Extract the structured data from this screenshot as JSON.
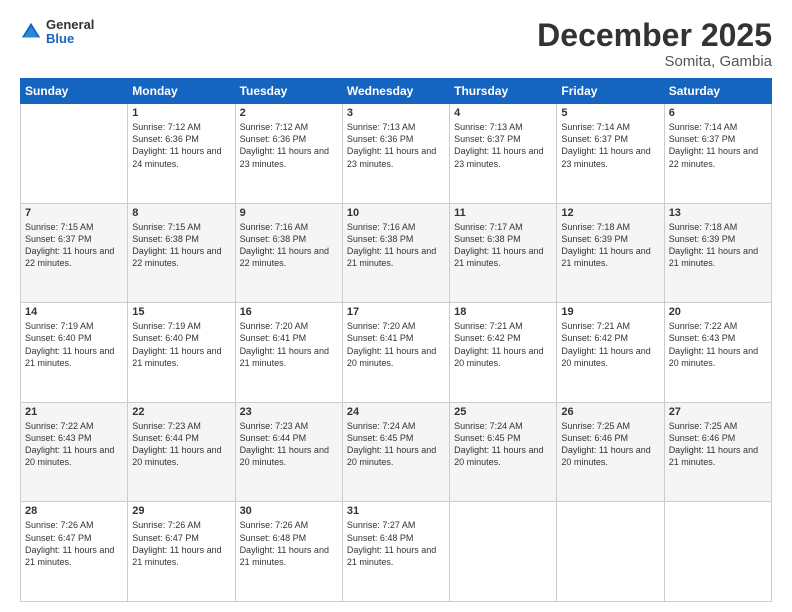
{
  "header": {
    "logo": {
      "general": "General",
      "blue": "Blue"
    },
    "title": "December 2025",
    "subtitle": "Somita, Gambia"
  },
  "days_of_week": [
    "Sunday",
    "Monday",
    "Tuesday",
    "Wednesday",
    "Thursday",
    "Friday",
    "Saturday"
  ],
  "weeks": [
    [
      {
        "day": "",
        "sunrise": "",
        "sunset": "",
        "daylight": ""
      },
      {
        "day": "1",
        "sunrise": "Sunrise: 7:12 AM",
        "sunset": "Sunset: 6:36 PM",
        "daylight": "Daylight: 11 hours and 24 minutes."
      },
      {
        "day": "2",
        "sunrise": "Sunrise: 7:12 AM",
        "sunset": "Sunset: 6:36 PM",
        "daylight": "Daylight: 11 hours and 23 minutes."
      },
      {
        "day": "3",
        "sunrise": "Sunrise: 7:13 AM",
        "sunset": "Sunset: 6:36 PM",
        "daylight": "Daylight: 11 hours and 23 minutes."
      },
      {
        "day": "4",
        "sunrise": "Sunrise: 7:13 AM",
        "sunset": "Sunset: 6:37 PM",
        "daylight": "Daylight: 11 hours and 23 minutes."
      },
      {
        "day": "5",
        "sunrise": "Sunrise: 7:14 AM",
        "sunset": "Sunset: 6:37 PM",
        "daylight": "Daylight: 11 hours and 23 minutes."
      },
      {
        "day": "6",
        "sunrise": "Sunrise: 7:14 AM",
        "sunset": "Sunset: 6:37 PM",
        "daylight": "Daylight: 11 hours and 22 minutes."
      }
    ],
    [
      {
        "day": "7",
        "sunrise": "Sunrise: 7:15 AM",
        "sunset": "Sunset: 6:37 PM",
        "daylight": "Daylight: 11 hours and 22 minutes."
      },
      {
        "day": "8",
        "sunrise": "Sunrise: 7:15 AM",
        "sunset": "Sunset: 6:38 PM",
        "daylight": "Daylight: 11 hours and 22 minutes."
      },
      {
        "day": "9",
        "sunrise": "Sunrise: 7:16 AM",
        "sunset": "Sunset: 6:38 PM",
        "daylight": "Daylight: 11 hours and 22 minutes."
      },
      {
        "day": "10",
        "sunrise": "Sunrise: 7:16 AM",
        "sunset": "Sunset: 6:38 PM",
        "daylight": "Daylight: 11 hours and 21 minutes."
      },
      {
        "day": "11",
        "sunrise": "Sunrise: 7:17 AM",
        "sunset": "Sunset: 6:38 PM",
        "daylight": "Daylight: 11 hours and 21 minutes."
      },
      {
        "day": "12",
        "sunrise": "Sunrise: 7:18 AM",
        "sunset": "Sunset: 6:39 PM",
        "daylight": "Daylight: 11 hours and 21 minutes."
      },
      {
        "day": "13",
        "sunrise": "Sunrise: 7:18 AM",
        "sunset": "Sunset: 6:39 PM",
        "daylight": "Daylight: 11 hours and 21 minutes."
      }
    ],
    [
      {
        "day": "14",
        "sunrise": "Sunrise: 7:19 AM",
        "sunset": "Sunset: 6:40 PM",
        "daylight": "Daylight: 11 hours and 21 minutes."
      },
      {
        "day": "15",
        "sunrise": "Sunrise: 7:19 AM",
        "sunset": "Sunset: 6:40 PM",
        "daylight": "Daylight: 11 hours and 21 minutes."
      },
      {
        "day": "16",
        "sunrise": "Sunrise: 7:20 AM",
        "sunset": "Sunset: 6:41 PM",
        "daylight": "Daylight: 11 hours and 21 minutes."
      },
      {
        "day": "17",
        "sunrise": "Sunrise: 7:20 AM",
        "sunset": "Sunset: 6:41 PM",
        "daylight": "Daylight: 11 hours and 20 minutes."
      },
      {
        "day": "18",
        "sunrise": "Sunrise: 7:21 AM",
        "sunset": "Sunset: 6:42 PM",
        "daylight": "Daylight: 11 hours and 20 minutes."
      },
      {
        "day": "19",
        "sunrise": "Sunrise: 7:21 AM",
        "sunset": "Sunset: 6:42 PM",
        "daylight": "Daylight: 11 hours and 20 minutes."
      },
      {
        "day": "20",
        "sunrise": "Sunrise: 7:22 AM",
        "sunset": "Sunset: 6:43 PM",
        "daylight": "Daylight: 11 hours and 20 minutes."
      }
    ],
    [
      {
        "day": "21",
        "sunrise": "Sunrise: 7:22 AM",
        "sunset": "Sunset: 6:43 PM",
        "daylight": "Daylight: 11 hours and 20 minutes."
      },
      {
        "day": "22",
        "sunrise": "Sunrise: 7:23 AM",
        "sunset": "Sunset: 6:44 PM",
        "daylight": "Daylight: 11 hours and 20 minutes."
      },
      {
        "day": "23",
        "sunrise": "Sunrise: 7:23 AM",
        "sunset": "Sunset: 6:44 PM",
        "daylight": "Daylight: 11 hours and 20 minutes."
      },
      {
        "day": "24",
        "sunrise": "Sunrise: 7:24 AM",
        "sunset": "Sunset: 6:45 PM",
        "daylight": "Daylight: 11 hours and 20 minutes."
      },
      {
        "day": "25",
        "sunrise": "Sunrise: 7:24 AM",
        "sunset": "Sunset: 6:45 PM",
        "daylight": "Daylight: 11 hours and 20 minutes."
      },
      {
        "day": "26",
        "sunrise": "Sunrise: 7:25 AM",
        "sunset": "Sunset: 6:46 PM",
        "daylight": "Daylight: 11 hours and 20 minutes."
      },
      {
        "day": "27",
        "sunrise": "Sunrise: 7:25 AM",
        "sunset": "Sunset: 6:46 PM",
        "daylight": "Daylight: 11 hours and 21 minutes."
      }
    ],
    [
      {
        "day": "28",
        "sunrise": "Sunrise: 7:26 AM",
        "sunset": "Sunset: 6:47 PM",
        "daylight": "Daylight: 11 hours and 21 minutes."
      },
      {
        "day": "29",
        "sunrise": "Sunrise: 7:26 AM",
        "sunset": "Sunset: 6:47 PM",
        "daylight": "Daylight: 11 hours and 21 minutes."
      },
      {
        "day": "30",
        "sunrise": "Sunrise: 7:26 AM",
        "sunset": "Sunset: 6:48 PM",
        "daylight": "Daylight: 11 hours and 21 minutes."
      },
      {
        "day": "31",
        "sunrise": "Sunrise: 7:27 AM",
        "sunset": "Sunset: 6:48 PM",
        "daylight": "Daylight: 11 hours and 21 minutes."
      },
      {
        "day": "",
        "sunrise": "",
        "sunset": "",
        "daylight": ""
      },
      {
        "day": "",
        "sunrise": "",
        "sunset": "",
        "daylight": ""
      },
      {
        "day": "",
        "sunrise": "",
        "sunset": "",
        "daylight": ""
      }
    ]
  ]
}
